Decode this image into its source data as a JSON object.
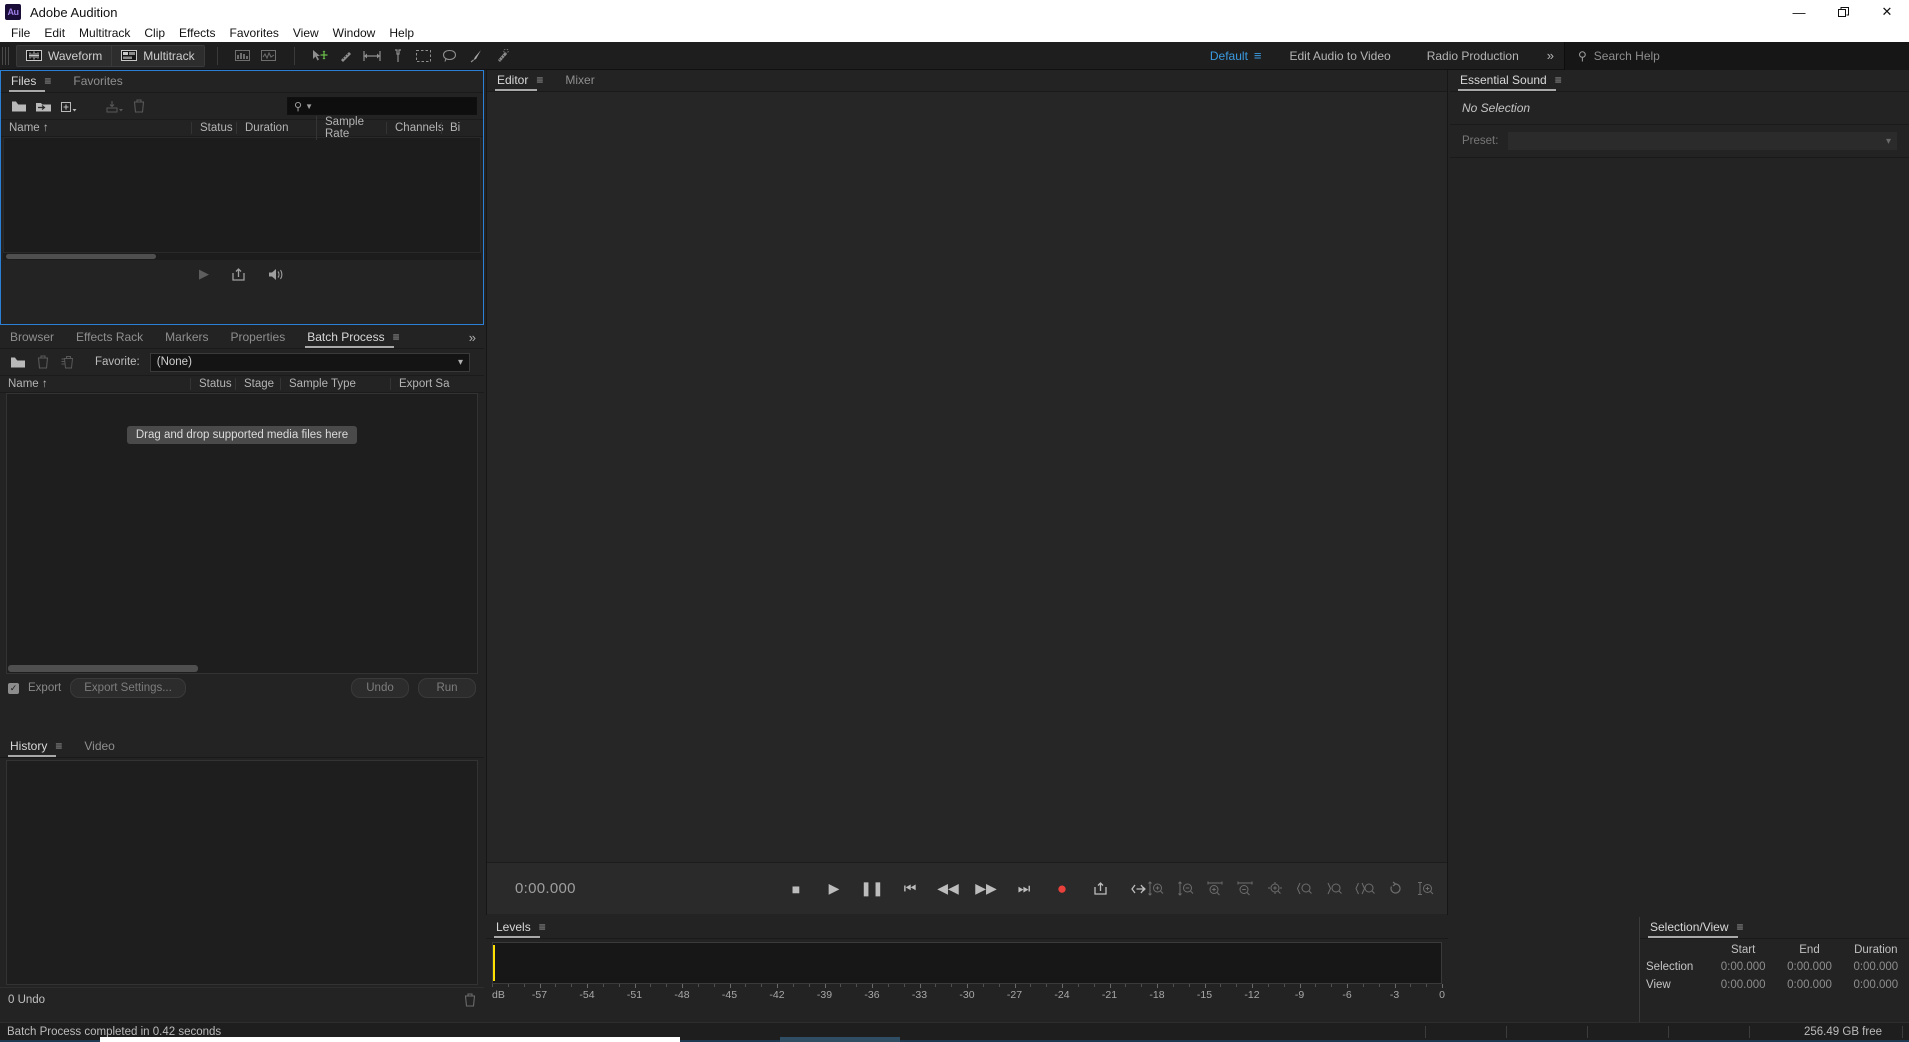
{
  "window": {
    "app_name": "Adobe Audition",
    "logo_text": "Au",
    "minimize": "—",
    "maximize": "❐",
    "close": "✕"
  },
  "menubar": {
    "items": [
      "File",
      "Edit",
      "Multitrack",
      "Clip",
      "Effects",
      "Favorites",
      "View",
      "Window",
      "Help"
    ]
  },
  "toolbar": {
    "modes": [
      {
        "label": "Waveform",
        "icon": "waveform-icon"
      },
      {
        "label": "Multitrack",
        "icon": "multitrack-icon"
      }
    ],
    "view_icons": [
      "spectral-frequency-icon",
      "spectral-pitch-icon"
    ],
    "tool_icons": [
      "move-tool-icon",
      "slip-tool-icon",
      "time-selection-icon",
      "razor-tool-icon",
      "marquee-selection-icon",
      "lasso-selection-icon",
      "paintbrush-selection-icon",
      "spot-healing-brush-icon"
    ],
    "workspaces": {
      "active": "Default",
      "hamburger": "≡",
      "items": [
        "Edit Audio to Video",
        "Radio Production"
      ],
      "overflow": "»"
    },
    "search": {
      "placeholder": "Search Help",
      "icon": "search-icon"
    }
  },
  "files_panel": {
    "tabs": [
      {
        "label": "Files",
        "active": true,
        "hamburger": "≡"
      },
      {
        "label": "Favorites",
        "active": false
      }
    ],
    "toolbar_icons": [
      "open-file-icon",
      "import-file-icon",
      "new-file-icon",
      "insert-into-multitrack-icon",
      "close-selected-files-icon"
    ],
    "search_placeholder": "",
    "columns": [
      "Name",
      "Status",
      "Duration",
      "Sample Rate",
      "Channels",
      "Bi"
    ],
    "sort_indicator": "↑",
    "rows": [],
    "transport_icons": [
      "play-icon",
      "auto-play-icon",
      "volume-icon"
    ]
  },
  "batch_panel": {
    "tabs": [
      {
        "label": "Browser",
        "active": false
      },
      {
        "label": "Effects Rack",
        "active": false
      },
      {
        "label": "Markers",
        "active": false
      },
      {
        "label": "Properties",
        "active": false
      },
      {
        "label": "Batch Process",
        "active": true,
        "hamburger": "≡"
      }
    ],
    "overflow": "»",
    "toolbar_icons": [
      "open-files-icon",
      "remove-file-icon",
      "clear-all-icon"
    ],
    "favorite_label": "Favorite:",
    "favorite_value": "(None)",
    "favorite_options": [
      "(None)"
    ],
    "columns": [
      "Name",
      "Status",
      "Stage",
      "Sample Type",
      "Export Sa"
    ],
    "sort_indicator": "↑",
    "drop_hint": "Drag and drop supported media files here",
    "export_checked": true,
    "export_label": "Export",
    "export_settings_label": "Export Settings...",
    "undo_label": "Undo",
    "run_label": "Run"
  },
  "history_panel": {
    "tabs": [
      {
        "label": "History",
        "active": true,
        "hamburger": "≡"
      },
      {
        "label": "Video",
        "active": false
      }
    ],
    "undo_count": "0 Undo",
    "trash_icon": "trash-icon"
  },
  "editor_panel": {
    "tabs": [
      {
        "label": "Editor",
        "active": true,
        "hamburger": "≡"
      },
      {
        "label": "Mixer",
        "active": false
      }
    ],
    "time_display": "0:00.000",
    "transport_icons": [
      "stop-icon",
      "play-icon",
      "pause-icon",
      "move-playhead-to-previous-icon",
      "rewind-icon",
      "fast-forward-icon",
      "move-playhead-to-next-icon",
      "record-icon",
      "loop-playback-icon",
      "skip-selection-icon"
    ],
    "zoom_icons": [
      "zoom-in-amplitude-icon",
      "zoom-out-amplitude-icon",
      "zoom-in-time-icon",
      "zoom-out-time-icon",
      "zoom-out-full-icon",
      "zoom-to-selection-in-point-icon",
      "zoom-to-selection-out-point-icon",
      "zoom-to-selection-icon",
      "toggle-vertical-zoom-icon",
      "zoom-amplitude-icon"
    ]
  },
  "levels_panel": {
    "tabs": [
      {
        "label": "Levels",
        "active": true,
        "hamburger": "≡"
      }
    ],
    "db_label": "dB",
    "ticks": [
      -57,
      -54,
      -51,
      -48,
      -45,
      -42,
      -39,
      -36,
      -33,
      -30,
      -27,
      -24,
      -21,
      -18,
      -15,
      -12,
      -9,
      -6,
      -3,
      0
    ],
    "scale_min": -60,
    "scale_max": 0
  },
  "essential_sound_panel": {
    "tabs": [
      {
        "label": "Essential Sound",
        "active": true,
        "hamburger": "≡"
      }
    ],
    "no_selection": "No Selection",
    "preset_label": "Preset:",
    "preset_value": ""
  },
  "selection_view_panel": {
    "tabs": [
      {
        "label": "Selection/View",
        "active": true,
        "hamburger": "≡"
      }
    ],
    "columns": [
      "",
      "Start",
      "End",
      "Duration"
    ],
    "rows": [
      {
        "label": "Selection",
        "start": "0:00.000",
        "end": "0:00.000",
        "duration": "0:00.000"
      },
      {
        "label": "View",
        "start": "0:00.000",
        "end": "0:00.000",
        "duration": "0:00.000"
      }
    ]
  },
  "statusbar": {
    "message": "Batch Process completed in 0.42 seconds",
    "free_space": "256.49 GB free"
  },
  "colors": {
    "accent_blue": "#3b9ae1",
    "panel_focus_border": "#2b7fd4",
    "record_red": "#e8403a",
    "meter_yellow": "#ffe000",
    "bg": "#232323"
  }
}
